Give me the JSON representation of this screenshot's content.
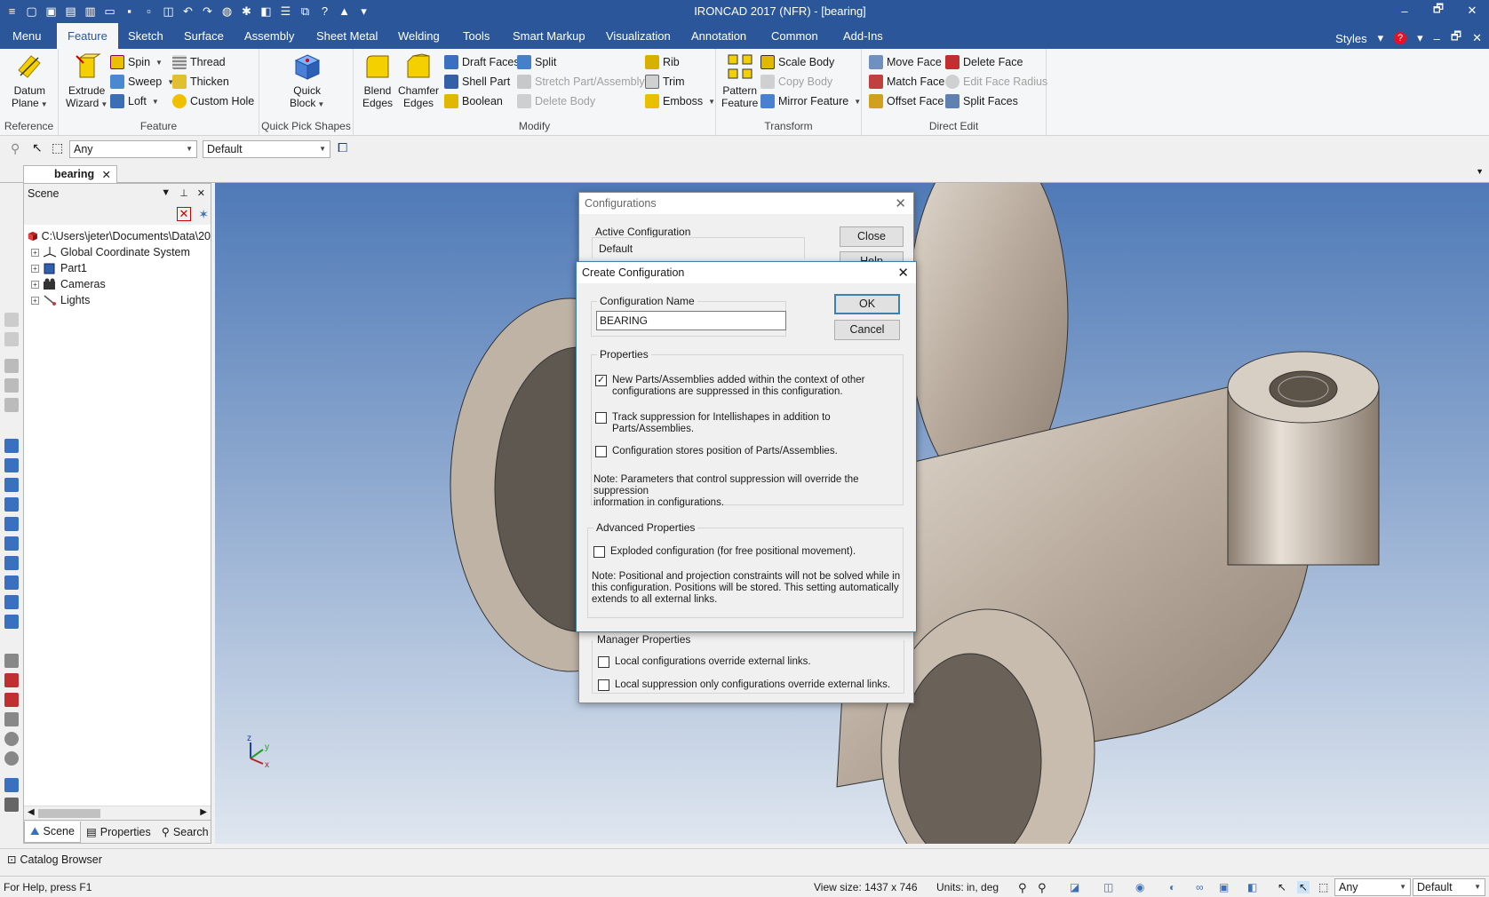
{
  "window": {
    "title": "IRONCAD 2017 (NFR) - [bearing]",
    "controls": [
      "–",
      "🗗",
      "✕"
    ]
  },
  "tabs": [
    "Menu",
    "Feature",
    "Sketch",
    "Surface",
    "Assembly",
    "Sheet Metal",
    "Welding",
    "Tools",
    "Smart Markup",
    "Visualization",
    "Annotation",
    "Common",
    "Add-Ins"
  ],
  "active_tab": "Feature",
  "tabbar_right": {
    "styles": "Styles"
  },
  "ribbon": {
    "reference": {
      "label": "Reference",
      "datum_plane": [
        "Datum",
        "Plane"
      ]
    },
    "feature": {
      "label": "Feature",
      "extrude_wizard": [
        "Extrude",
        "Wizard"
      ],
      "spin": "Spin",
      "sweep": "Sweep",
      "loft": "Loft",
      "thread": "Thread",
      "thicken": "Thicken",
      "custom_hole": "Custom Hole"
    },
    "quick_pick": {
      "label": "Quick Pick Shapes",
      "quick_block": [
        "Quick",
        "Block"
      ]
    },
    "modify": {
      "label": "Modify",
      "blend_edges": [
        "Blend",
        "Edges"
      ],
      "chamfer_edges": [
        "Chamfer",
        "Edges"
      ],
      "draft_faces": "Draft Faces",
      "shell_part": "Shell Part",
      "boolean": "Boolean",
      "split": "Split",
      "stretch": "Stretch Part/Assembly",
      "delete_body": "Delete Body",
      "rib": "Rib",
      "trim": "Trim",
      "emboss": "Emboss"
    },
    "transform": {
      "label": "Transform",
      "pattern_feature": [
        "Pattern",
        "Feature"
      ],
      "scale_body": "Scale Body",
      "copy_body": "Copy Body",
      "mirror_feature": "Mirror Feature"
    },
    "direct_edit": {
      "label": "Direct Edit",
      "move_face": "Move Face",
      "match_face": "Match Face",
      "offset_face": "Offset Face",
      "delete_face": "Delete Face",
      "edit_face_radius": "Edit Face Radius",
      "split_faces": "Split Faces"
    }
  },
  "toolbar": {
    "filter": "Any",
    "config": "Default"
  },
  "doc_tab": "bearing",
  "scene": {
    "title": "Scene",
    "tree": [
      {
        "label": "C:\\Users\\jeter\\Documents\\Data\\20",
        "icon": "scene-root-icon"
      },
      {
        "label": "Global Coordinate System",
        "icon": "axes-icon"
      },
      {
        "label": "Part1",
        "icon": "part-icon"
      },
      {
        "label": "Cameras",
        "icon": "camera-icon"
      },
      {
        "label": "Lights",
        "icon": "light-icon"
      }
    ],
    "footer_tabs": [
      "Scene",
      "Properties",
      "Search"
    ]
  },
  "configurations_dialog": {
    "title": "Configurations",
    "active_label": "Active Configuration",
    "active_value": "Default",
    "close": "Close",
    "help": "Help",
    "manager_label": "Manager Properties",
    "manager_opts": [
      "Local configurations override external links.",
      "Local suppression only configurations override external links."
    ]
  },
  "create_dialog": {
    "title": "Create Configuration",
    "name_label": "Configuration Name",
    "name_value": "BEARING",
    "ok": "OK",
    "cancel": "Cancel",
    "properties_label": "Properties",
    "opt1_l1": "New Parts/Assemblies added within the context of other",
    "opt1_l2": "configurations are suppressed in this configuration.",
    "opt2": "Track suppression for Intellishapes in addition to Parts/Assemblies.",
    "opt3": "Configuration stores position of Parts/Assemblies.",
    "note1_l1": "Note: Parameters that control suppression will override the suppression",
    "note1_l2": "information in configurations.",
    "adv_label": "Advanced Properties",
    "opt4": "Exploded configuration (for free positional movement).",
    "note2_l1": "Note: Positional and projection constraints will not be solved while in",
    "note2_l2": "this configuration. Positions will be stored.  This setting automatically",
    "note2_l3": "extends to all external links.",
    "checked": [
      true,
      false,
      false,
      false
    ]
  },
  "catalog": "Catalog Browser",
  "status": {
    "help": "For Help, press F1",
    "view_size": "View size: 1437 x  746",
    "units": "Units: in, deg",
    "filter": "Any",
    "config": "Default"
  },
  "axis_labels": {
    "z": "z",
    "y": "y",
    "x": "x"
  }
}
